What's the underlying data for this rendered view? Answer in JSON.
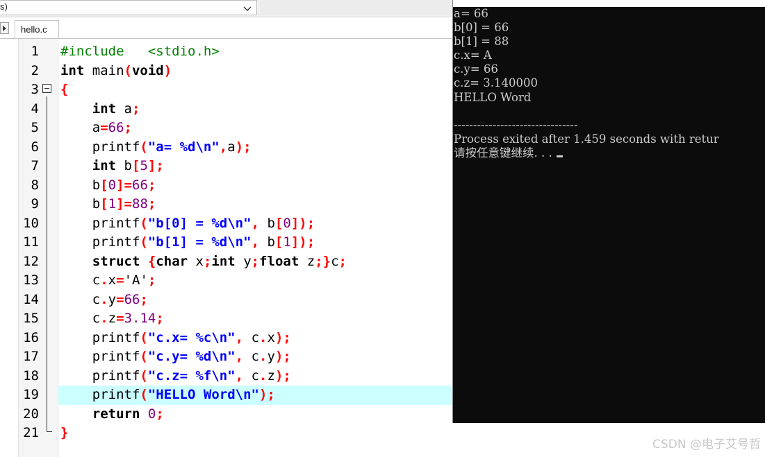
{
  "toolbar": {
    "combo_text": "s)",
    "combo_icon": "chevron-down-icon"
  },
  "tabs": [
    {
      "label": "hello.c"
    }
  ],
  "editor": {
    "active_line": 19,
    "colors": {
      "keyword": "#000000",
      "preprocessor": "#008000",
      "string": "#0000ff",
      "symbol": "#ff0000",
      "number": "#800080",
      "active_line_bg": "#ccffff"
    },
    "lines": [
      {
        "n": "1",
        "tokens": [
          [
            "pp",
            "#include   <stdio.h>"
          ]
        ]
      },
      {
        "n": "2",
        "tokens": [
          [
            "kw",
            "int"
          ],
          [
            "txt",
            " main"
          ],
          [
            "sym",
            "("
          ],
          [
            "kw",
            "void"
          ],
          [
            "sym",
            ")"
          ]
        ]
      },
      {
        "n": "3",
        "tokens": [
          [
            "sym",
            "{"
          ]
        ]
      },
      {
        "n": "4",
        "tokens": [
          [
            "txt",
            "    "
          ],
          [
            "kw",
            "int"
          ],
          [
            "txt",
            " a"
          ],
          [
            "sym",
            ";"
          ]
        ]
      },
      {
        "n": "5",
        "tokens": [
          [
            "txt",
            "    a"
          ],
          [
            "sym",
            "="
          ],
          [
            "num",
            "66"
          ],
          [
            "sym",
            ";"
          ]
        ]
      },
      {
        "n": "6",
        "tokens": [
          [
            "txt",
            "    printf"
          ],
          [
            "sym",
            "("
          ],
          [
            "str",
            "\"a= %d\\n\""
          ],
          [
            "sym",
            ","
          ],
          [
            "txt",
            "a"
          ],
          [
            "sym",
            ");"
          ]
        ]
      },
      {
        "n": "7",
        "tokens": [
          [
            "txt",
            "    "
          ],
          [
            "kw",
            "int"
          ],
          [
            "txt",
            " b"
          ],
          [
            "sym",
            "["
          ],
          [
            "num",
            "5"
          ],
          [
            "sym",
            "];"
          ]
        ]
      },
      {
        "n": "8",
        "tokens": [
          [
            "txt",
            "    b"
          ],
          [
            "sym",
            "["
          ],
          [
            "num",
            "0"
          ],
          [
            "sym",
            "]="
          ],
          [
            "num",
            "66"
          ],
          [
            "sym",
            ";"
          ]
        ]
      },
      {
        "n": "9",
        "tokens": [
          [
            "txt",
            "    b"
          ],
          [
            "sym",
            "["
          ],
          [
            "num",
            "1"
          ],
          [
            "sym",
            "]="
          ],
          [
            "num",
            "88"
          ],
          [
            "sym",
            ";"
          ]
        ]
      },
      {
        "n": "10",
        "tokens": [
          [
            "txt",
            "    printf"
          ],
          [
            "sym",
            "("
          ],
          [
            "str",
            "\"b[0] = %d\\n\""
          ],
          [
            "sym",
            ","
          ],
          [
            "txt",
            " b"
          ],
          [
            "sym",
            "["
          ],
          [
            "num",
            "0"
          ],
          [
            "sym",
            "]);"
          ]
        ]
      },
      {
        "n": "11",
        "tokens": [
          [
            "txt",
            "    printf"
          ],
          [
            "sym",
            "("
          ],
          [
            "str",
            "\"b[1] = %d\\n\""
          ],
          [
            "sym",
            ","
          ],
          [
            "txt",
            " b"
          ],
          [
            "sym",
            "["
          ],
          [
            "num",
            "1"
          ],
          [
            "sym",
            "]);"
          ]
        ]
      },
      {
        "n": "12",
        "tokens": [
          [
            "txt",
            "    "
          ],
          [
            "kw",
            "struct"
          ],
          [
            "txt",
            " "
          ],
          [
            "sym",
            "{"
          ],
          [
            "kw",
            "char"
          ],
          [
            "txt",
            " x"
          ],
          [
            "sym",
            ";"
          ],
          [
            "kw",
            "int"
          ],
          [
            "txt",
            " y"
          ],
          [
            "sym",
            ";"
          ],
          [
            "kw",
            "float"
          ],
          [
            "txt",
            " z"
          ],
          [
            "sym",
            ";}"
          ],
          [
            "txt",
            "c"
          ],
          [
            "sym",
            ";"
          ]
        ]
      },
      {
        "n": "13",
        "tokens": [
          [
            "txt",
            "    c"
          ],
          [
            "sym",
            "."
          ],
          [
            "txt",
            "x"
          ],
          [
            "sym",
            "="
          ],
          [
            "txt",
            "'A'"
          ],
          [
            "sym",
            ";"
          ]
        ]
      },
      {
        "n": "14",
        "tokens": [
          [
            "txt",
            "    c"
          ],
          [
            "sym",
            "."
          ],
          [
            "txt",
            "y"
          ],
          [
            "sym",
            "="
          ],
          [
            "num",
            "66"
          ],
          [
            "sym",
            ";"
          ]
        ]
      },
      {
        "n": "15",
        "tokens": [
          [
            "txt",
            "    c"
          ],
          [
            "sym",
            "."
          ],
          [
            "txt",
            "z"
          ],
          [
            "sym",
            "="
          ],
          [
            "num",
            "3.14"
          ],
          [
            "sym",
            ";"
          ]
        ]
      },
      {
        "n": "16",
        "tokens": [
          [
            "txt",
            "    printf"
          ],
          [
            "sym",
            "("
          ],
          [
            "str",
            "\"c.x= %c\\n\""
          ],
          [
            "sym",
            ","
          ],
          [
            "txt",
            " c"
          ],
          [
            "sym",
            "."
          ],
          [
            "txt",
            "x"
          ],
          [
            "sym",
            ");"
          ]
        ]
      },
      {
        "n": "17",
        "tokens": [
          [
            "txt",
            "    printf"
          ],
          [
            "sym",
            "("
          ],
          [
            "str",
            "\"c.y= %d\\n\""
          ],
          [
            "sym",
            ","
          ],
          [
            "txt",
            " c"
          ],
          [
            "sym",
            "."
          ],
          [
            "txt",
            "y"
          ],
          [
            "sym",
            ");"
          ]
        ]
      },
      {
        "n": "18",
        "tokens": [
          [
            "txt",
            "    printf"
          ],
          [
            "sym",
            "("
          ],
          [
            "str",
            "\"c.z= %f\\n\""
          ],
          [
            "sym",
            ","
          ],
          [
            "txt",
            " c"
          ],
          [
            "sym",
            "."
          ],
          [
            "txt",
            "z"
          ],
          [
            "sym",
            ");"
          ]
        ]
      },
      {
        "n": "19",
        "tokens": [
          [
            "txt",
            "    printf"
          ],
          [
            "sym",
            "("
          ],
          [
            "str",
            "\"HELLO Word\\n\""
          ],
          [
            "sym",
            ");"
          ]
        ]
      },
      {
        "n": "20",
        "tokens": [
          [
            "txt",
            "    "
          ],
          [
            "kw",
            "return"
          ],
          [
            "txt",
            " "
          ],
          [
            "num",
            "0"
          ],
          [
            "sym",
            ";"
          ]
        ]
      },
      {
        "n": "21",
        "tokens": [
          [
            "sym",
            "}"
          ]
        ]
      }
    ]
  },
  "console": {
    "background": "#0c0c0c",
    "text_color": "#cccccc",
    "lines": [
      "a= 66",
      "b[0] = 66",
      "b[1] = 88",
      "c.x= A",
      "c.y= 66",
      "c.z= 3.140000",
      "HELLO Word",
      "",
      "--------------------------------",
      "Process exited after 1.459 seconds with retur",
      "请按任意键继续. . ."
    ]
  },
  "watermark": "CSDN @电子艾号哲"
}
